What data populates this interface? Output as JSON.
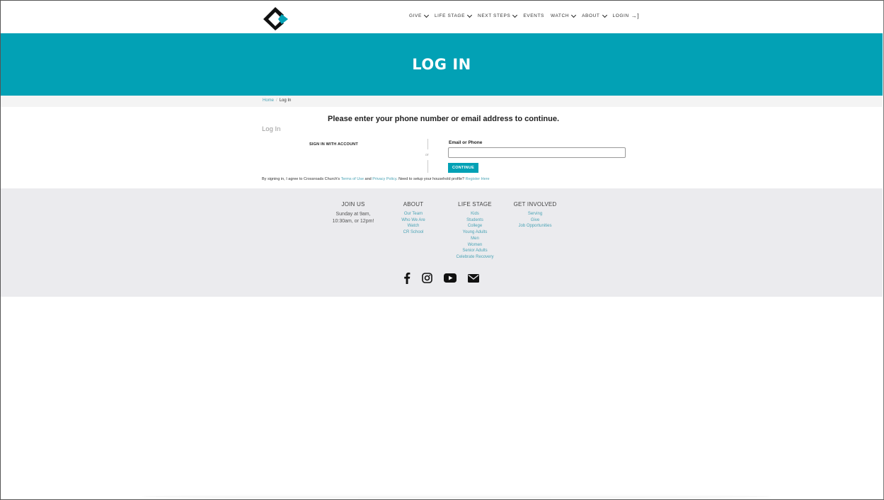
{
  "nav": {
    "items": [
      {
        "label": "GIVE",
        "dropdown": true
      },
      {
        "label": "LIFE STAGE",
        "dropdown": true
      },
      {
        "label": "NEXT STEPS",
        "dropdown": true
      },
      {
        "label": "EVENTS",
        "dropdown": false
      },
      {
        "label": "WATCH",
        "dropdown": true
      },
      {
        "label": "ABOUT",
        "dropdown": true
      }
    ],
    "login_label": "LOGIN"
  },
  "banner": {
    "title": "LOG IN"
  },
  "breadcrumb": {
    "home": "Home",
    "separator": "/",
    "current": "Log In"
  },
  "main": {
    "prompt": "Please enter your phone number or email address to continue.",
    "section_title": "Log In",
    "sign_in_account": "SIGN IN WITH ACCOUNT",
    "or_label": "or",
    "field_label": "Email or Phone",
    "field_value": "",
    "field_placeholder": "",
    "continue_label": "CONTINUE",
    "terms": {
      "prefix": "By signing in, I agree to Crossroads Church's ",
      "terms_link": "Terms of Use",
      "and": " and ",
      "privacy_link": "Privacy Policy",
      "middle": ". Need to setup your household profile? ",
      "register_link": "Register Here"
    }
  },
  "footer": {
    "join": {
      "heading": "JOIN US",
      "line1": "Sunday at 9am,",
      "line2": "10:30am, or 12pm!"
    },
    "about": {
      "heading": "ABOUT",
      "links": [
        "Our Team",
        "Who We Are",
        "Watch",
        "CR School"
      ]
    },
    "life_stage": {
      "heading": "LIFE STAGE",
      "links": [
        "Kids",
        "Students",
        "College",
        "Young Adults",
        "Men",
        "Women",
        "Senior Adults",
        "Celebrate Recovery"
      ]
    },
    "get_involved": {
      "heading": "GET INVOLVED",
      "links": [
        "Serving",
        "Give",
        "Job Opportunities"
      ]
    },
    "social_icons": [
      "facebook-icon",
      "instagram-icon",
      "youtube-icon",
      "email-icon"
    ]
  },
  "colors": {
    "accent": "#02a1b5",
    "link": "#4aa3b5",
    "footer_bg": "#ebebee"
  }
}
